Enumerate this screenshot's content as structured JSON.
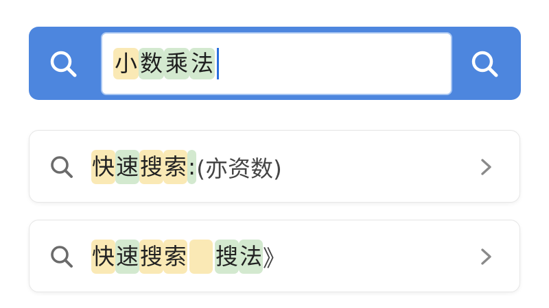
{
  "search": {
    "query_chars": [
      {
        "ch": "小",
        "hl": "y"
      },
      {
        "ch": "数",
        "hl": "g"
      },
      {
        "ch": "乘",
        "hl": "g"
      },
      {
        "ch": "法",
        "hl": "g"
      }
    ],
    "left_icon": "search-icon",
    "right_icon": "search-icon",
    "colors": {
      "bar": "#4d86de",
      "highlight_yellow": "#fae9b5",
      "highlight_green": "#d3e9cf",
      "caret": "#2a6fdc"
    }
  },
  "suggestions": [
    {
      "icon": "search-icon",
      "chevron": "chevron-right-icon",
      "parts": [
        {
          "t": "快",
          "hl": "y"
        },
        {
          "t": "速",
          "hl": "g"
        },
        {
          "t": "搜",
          "hl": "y"
        },
        {
          "t": "索",
          "hl": "y"
        },
        {
          "t": ":",
          "hl": "g"
        },
        {
          "t": "(亦资数)",
          "hl": ""
        }
      ]
    },
    {
      "icon": "search-icon",
      "chevron": "chevron-right-icon",
      "parts": [
        {
          "t": "快",
          "hl": "y"
        },
        {
          "t": "速",
          "hl": "g"
        },
        {
          "t": "搜",
          "hl": "y"
        },
        {
          "t": "索",
          "hl": "y"
        },
        {
          "t": "",
          "hl": "y"
        },
        {
          "t": "搜",
          "hl": "g"
        },
        {
          "t": "法",
          "hl": "g"
        },
        {
          "t": "》",
          "hl": ""
        }
      ]
    }
  ]
}
